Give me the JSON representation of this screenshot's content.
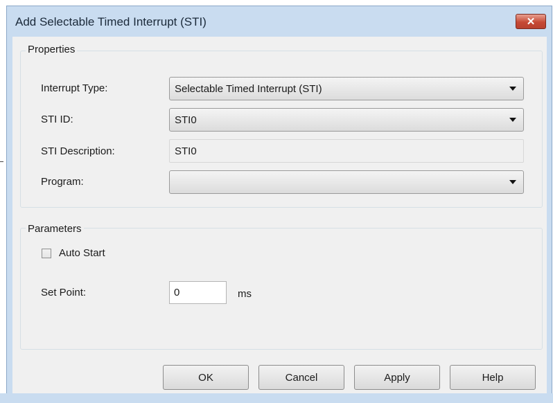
{
  "window": {
    "title": "Add Selectable Timed Interrupt (STI)",
    "close_glyph": "✕"
  },
  "properties": {
    "legend": "Properties",
    "interrupt_type_label": "Interrupt Type:",
    "interrupt_type_value": "Selectable Timed Interrupt (STI)",
    "sti_id_label": "STI ID:",
    "sti_id_value": "STI0",
    "sti_description_label": "STI Description:",
    "sti_description_value": "STI0",
    "program_label": "Program:",
    "program_value": ""
  },
  "parameters": {
    "legend": "Parameters",
    "auto_start_label": "Auto Start",
    "auto_start_checked": false,
    "set_point_label": "Set Point:",
    "set_point_value": "0",
    "set_point_unit": "ms"
  },
  "buttons": {
    "ok": "OK",
    "cancel": "Cancel",
    "apply": "Apply",
    "help": "Help"
  },
  "colors": {
    "title_bar": "#c9dcf0",
    "dialog_body": "#f0f0f0",
    "close_button": "#c64a36"
  }
}
